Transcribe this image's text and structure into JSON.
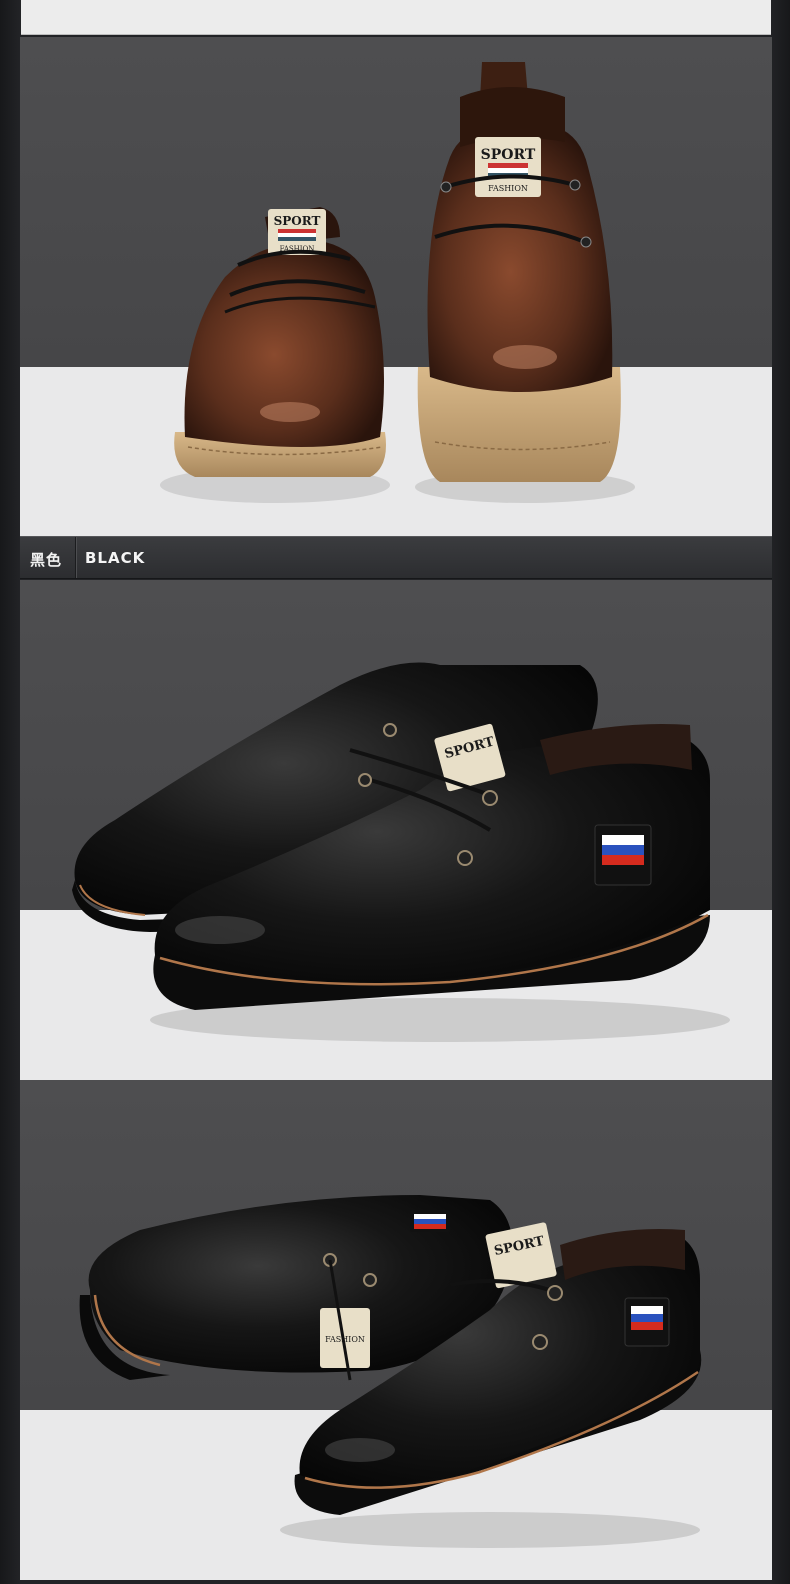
{
  "color_label": {
    "chinese": "黑色",
    "english": "BLACK"
  },
  "images": [
    {
      "alt": "brown",
      "shoe_color": "#5a2e1c"
    },
    {
      "alt": "black",
      "shoe_color": "#111111"
    },
    {
      "alt": "black",
      "shoe_color": "#101010"
    }
  ],
  "brand_tag": {
    "sport": "SPORT",
    "fashion": "FASHION"
  }
}
